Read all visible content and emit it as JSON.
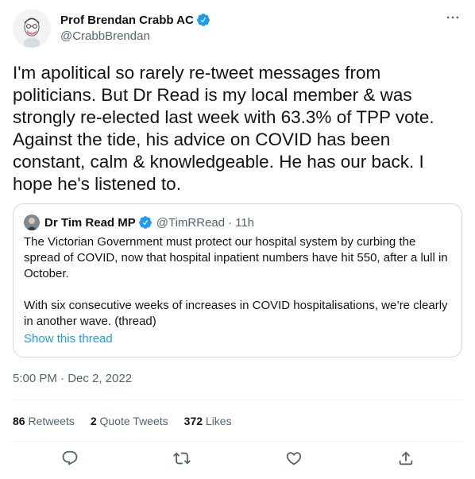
{
  "author": {
    "display_name": "Prof Brendan Crabb AC",
    "handle": "@CrabbBrendan"
  },
  "tweet": {
    "text": "I'm apolitical so rarely re-tweet messages from politicians. But Dr Read is my local member & was strongly re-elected last week with 63.3% of TPP vote. Against the tide, his advice on COVID has been constant, calm & knowledgeable. He has our back. I hope he's listened to.",
    "timestamp": "5:00 PM · Dec 2, 2022"
  },
  "quote": {
    "display_name": "Dr Tim Read MP",
    "handle": "@TimRRead",
    "separator": "·",
    "time": "11h",
    "paragraph_1": "The Victorian Government must protect our hospital system by curbing the spread of COVID, now that hospital inpatient numbers have hit 550, after a lull in October.",
    "paragraph_2": "With six consecutive weeks of increases in COVID hospitalisations, we’re clearly in another wave. (thread)",
    "link_label": "Show this thread"
  },
  "stats": {
    "retweets_count": "86",
    "retweets_label": "Retweets",
    "quotes_count": "2",
    "quotes_label": "Quote Tweets",
    "likes_count": "372",
    "likes_label": "Likes"
  },
  "colors": {
    "accent": "#1d9bf0",
    "secondary_text": "#536471",
    "border": "#cfd9de"
  },
  "icons": {
    "more": "more-horizontal-icon",
    "verified": "verified-badge-icon",
    "reply": "reply-icon",
    "retweet": "retweet-icon",
    "like": "heart-icon",
    "share": "share-icon"
  }
}
